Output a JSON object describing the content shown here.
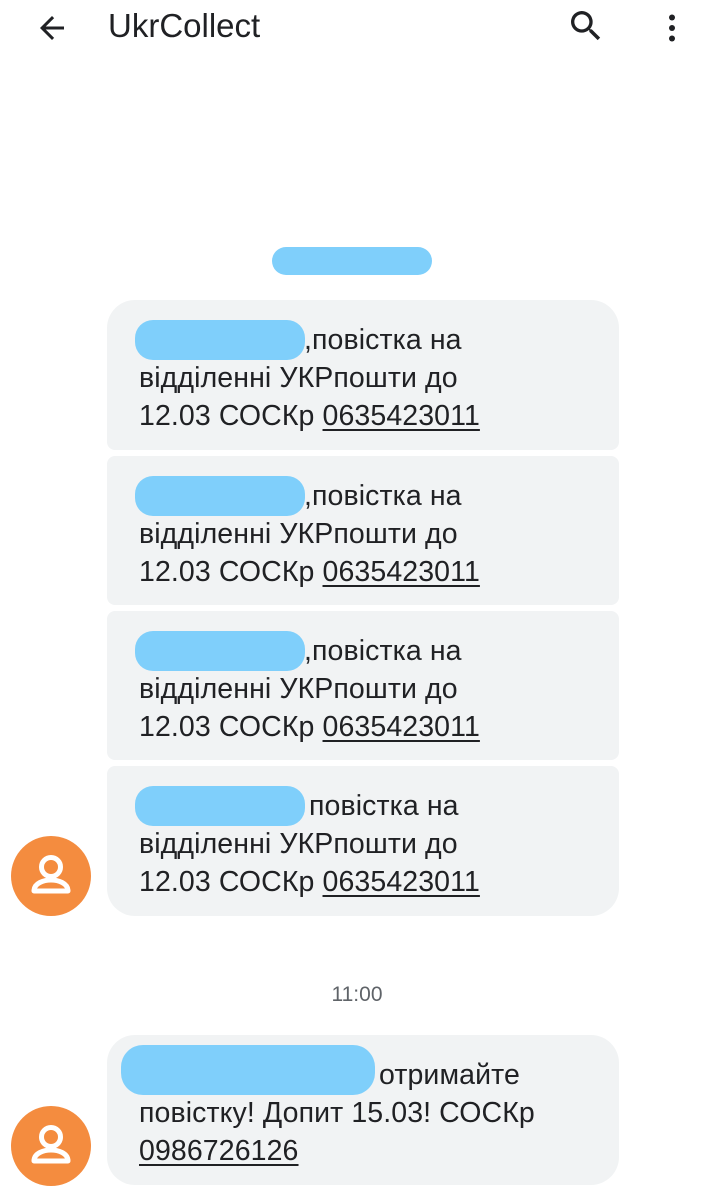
{
  "header": {
    "title": "UkrCollect",
    "back_icon": "arrow-back-icon",
    "search_icon": "search-icon",
    "menu_icon": "more-vert-icon"
  },
  "messages": [
    {
      "line1": ",повістка на",
      "line2": "відділенні УКРпошти до",
      "line3_text": "12.03 СОСКр ",
      "phone": "0635423011"
    },
    {
      "line1": ",повістка на",
      "line2": "відділенні УКРпошти до",
      "line3_text": "12.03 СОСКр ",
      "phone": "0635423011"
    },
    {
      "line1": ",повістка на",
      "line2": "відділенні УКРпошти до",
      "line3_text": "12.03 СОСКр ",
      "phone": "0635423011"
    },
    {
      "line1": "повістка на",
      "line2": "відділенні УКРпошти до",
      "line3_text": "12.03 СОСКр ",
      "phone": "0635423011"
    }
  ],
  "timestamp": "11:00",
  "last_message": {
    "line1": "отримайте",
    "line2": "повістку! Допит 15.03! СОСКр",
    "phone": "0986726126"
  },
  "colors": {
    "avatar": "#f48c3f",
    "bubble": "#f1f3f4",
    "redaction": "#7fcffb"
  }
}
